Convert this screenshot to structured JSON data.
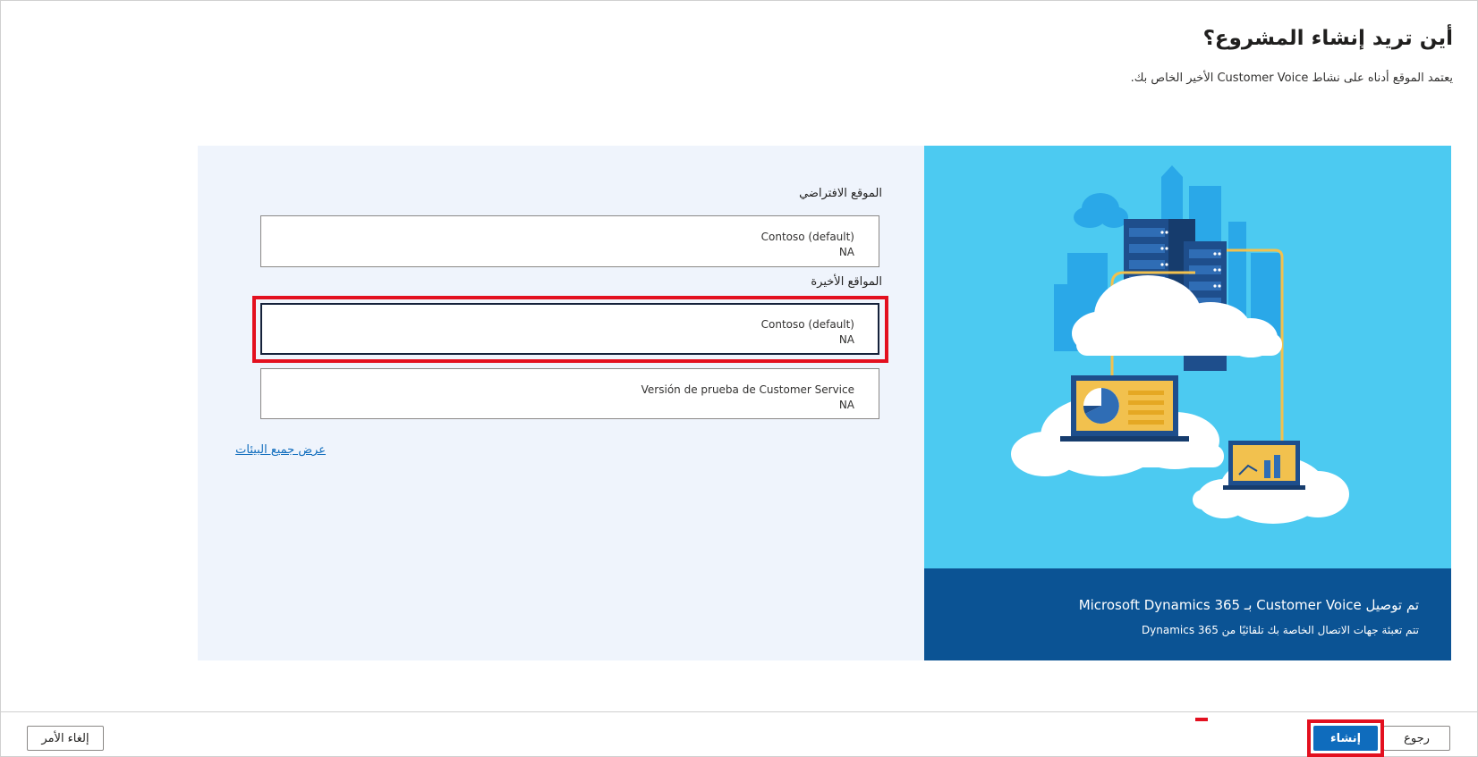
{
  "header": {
    "title": "أين تريد إنشاء المشروع؟",
    "subtitle": "يعتمد الموقع أدناه على نشاط Customer Voice الأخير الخاص بك."
  },
  "default_section": {
    "label": "الموقع الافتراضي",
    "card": {
      "name": "Contoso (default)",
      "region": "NA"
    }
  },
  "recent_section": {
    "label": "المواقع الأخيرة",
    "cards": [
      {
        "name": "Contoso (default)",
        "region": "NA",
        "selected": true
      },
      {
        "name": "Versión de prueba de Customer Service",
        "region": "NA",
        "selected": false
      }
    ]
  },
  "view_all_link": "عرض جميع البيئات",
  "banner": {
    "title": "تم توصيل Customer Voice بـ Microsoft Dynamics 365",
    "text": "تتم تعبئة جهات الاتصال الخاصة بك تلقائيًا من Dynamics 365"
  },
  "footer": {
    "back_label": "رجوع",
    "create_label": "إنشاء",
    "cancel_label": "إلغاء الأمر"
  },
  "colors": {
    "accent": "#0f6cbd",
    "highlight": "#e3101f",
    "panel_bg": "#eff4fc",
    "illustration_bg": "#4ccaf1",
    "banner_bg": "#0b5394"
  }
}
